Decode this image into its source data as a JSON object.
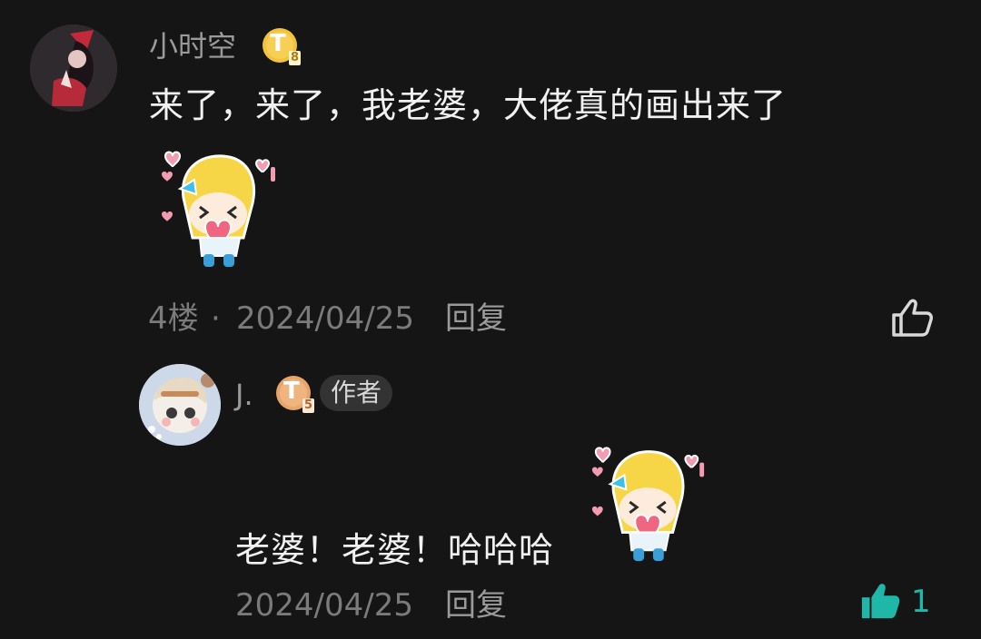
{
  "comment": {
    "username": "小时空",
    "level_letter": "T",
    "level_num": "8",
    "text": "来了，来了，我老婆，大佬真的画出来了",
    "floor": "4楼",
    "separator": "·",
    "date": "2024/04/25",
    "reply_label": "回复",
    "like_icon": "thumbs-up-outline-icon"
  },
  "reply": {
    "username": "J.",
    "level_letter": "T",
    "level_num": "5",
    "author_tag": "作者",
    "text": "老婆！老婆！哈哈哈",
    "date": "2024/04/25",
    "reply_label": "回复",
    "like_icon": "thumbs-up-filled-icon",
    "like_count": "1"
  },
  "colors": {
    "background": "#151515",
    "badge_gold": "#f4c23c",
    "badge_bronze": "#e8a56b",
    "like_active": "#1fb8a8"
  }
}
